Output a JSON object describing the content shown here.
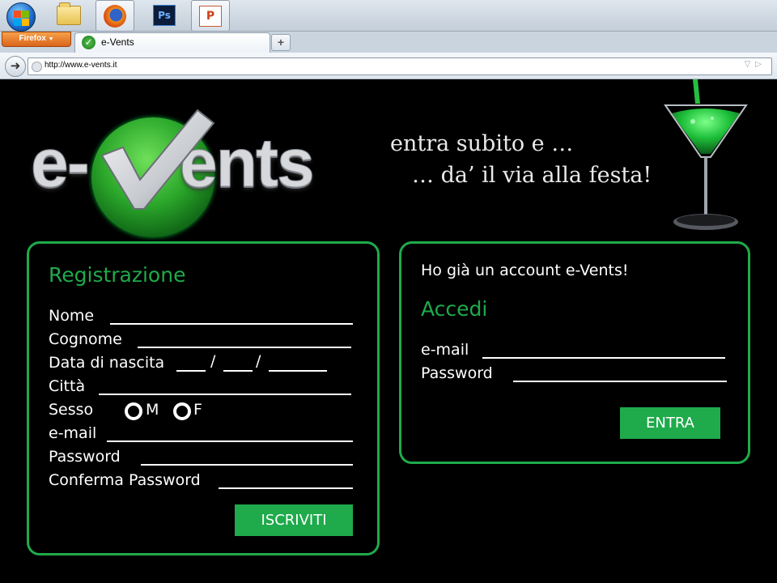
{
  "taskbar": {
    "items": [
      {
        "name": "start"
      },
      {
        "name": "explorer"
      },
      {
        "name": "firefox"
      },
      {
        "name": "photoshop",
        "icon_text": "Ps"
      },
      {
        "name": "powerpoint",
        "icon_text": "P"
      }
    ]
  },
  "browser": {
    "menu_button": "Firefox",
    "tab_title": "e-Vents",
    "new_tab_glyph": "+",
    "url": "http://www.e-vents.it"
  },
  "hero": {
    "logo_left": "e-",
    "logo_right": "ents",
    "tagline_line1": "entra subito e …",
    "tagline_line2": "… da’ il via alla festa!"
  },
  "registration": {
    "title": "Registrazione",
    "fields": {
      "nome": "Nome",
      "cognome": "Cognome",
      "data_nascita": "Data di nascita",
      "citta": "Città",
      "sesso": "Sesso",
      "email": "e-mail",
      "password": "Password",
      "conferma_password": "Conferma Password"
    },
    "date_separator": "/",
    "sex_options": {
      "male": "M",
      "female": "F"
    },
    "submit_label": "ISCRIVITI"
  },
  "login": {
    "intro": "Ho già un account e-Vents!",
    "title": "Accedi",
    "fields": {
      "email": "e-mail",
      "password": "Password"
    },
    "submit_label": "ENTRA"
  },
  "colors": {
    "accent_green": "#1faa4b",
    "background": "#000000",
    "text": "#ffffff"
  }
}
